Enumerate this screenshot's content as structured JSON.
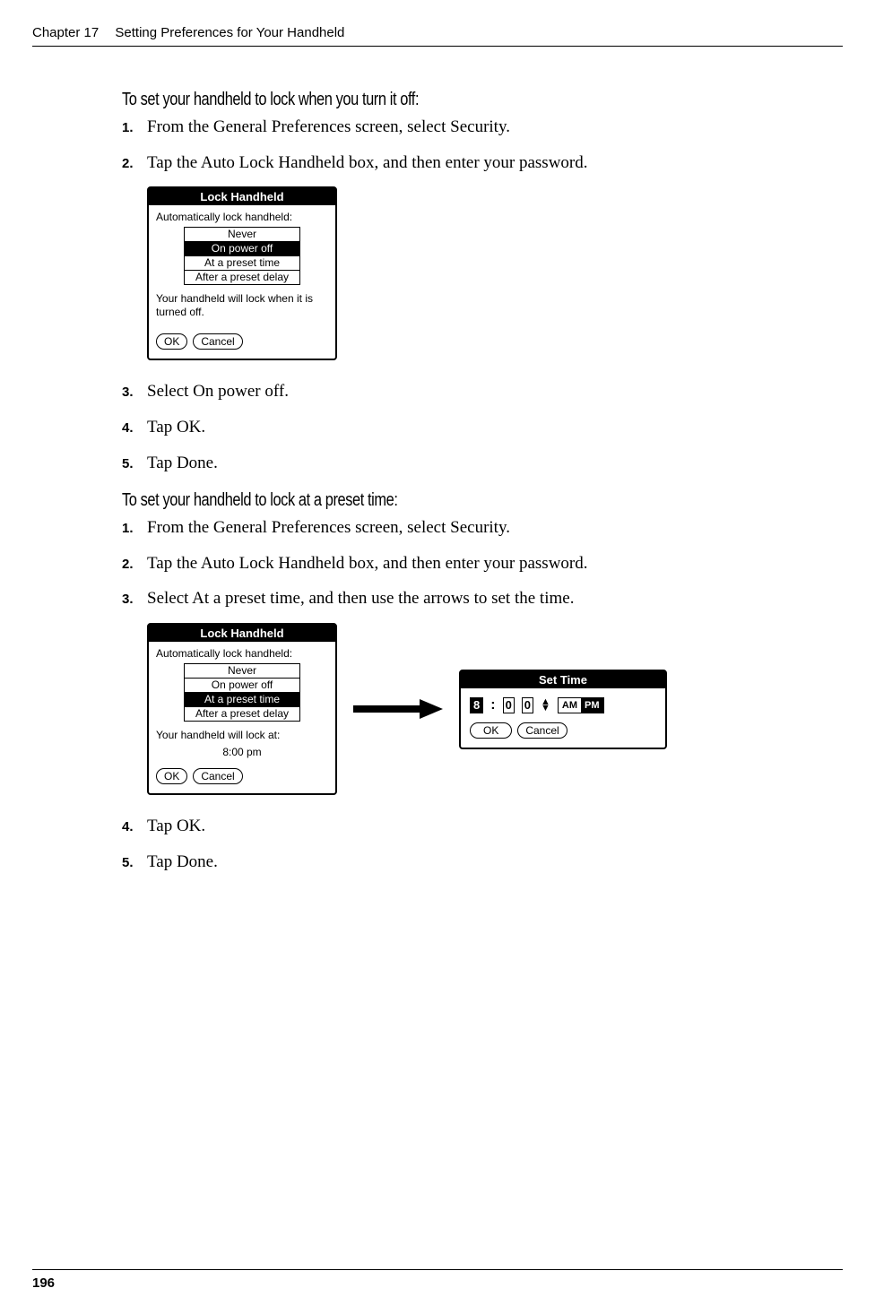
{
  "header": {
    "chapter": "Chapter 17",
    "title": "Setting Preferences for Your Handheld"
  },
  "section1": {
    "heading": "To set your handheld to lock when you turn it off:",
    "steps": [
      "From the General Preferences screen, select Security.",
      "Tap the Auto Lock Handheld box, and then enter your password.",
      "Select On power off.",
      "Tap OK.",
      "Tap Done."
    ]
  },
  "dialog1": {
    "title": "Lock Handheld",
    "prompt": "Automatically lock handheld:",
    "options": [
      "Never",
      "On power off",
      "At a preset time",
      "After a preset delay"
    ],
    "selected_index": 1,
    "note": "Your handheld will lock when it is turned off.",
    "ok": "OK",
    "cancel": "Cancel"
  },
  "section2": {
    "heading": "To set your handheld to lock at a preset time:",
    "steps": [
      "From the General Preferences screen, select Security.",
      "Tap the Auto Lock Handheld box, and then enter your password.",
      "Select At a preset time, and then use the arrows to set the time.",
      "Tap OK.",
      "Tap Done."
    ]
  },
  "dialog2": {
    "title": "Lock Handheld",
    "prompt": "Automatically lock handheld:",
    "options": [
      "Never",
      "On power off",
      "At a preset time",
      "After a preset delay"
    ],
    "selected_index": 2,
    "note": "Your handheld will lock at:",
    "time": "8:00 pm",
    "ok": "OK",
    "cancel": "Cancel"
  },
  "settime": {
    "title": "Set Time",
    "hour": "8",
    "min1": "0",
    "min2": "0",
    "am": "AM",
    "pm": "PM",
    "ampm_selected": "PM",
    "ok": "OK",
    "cancel": "Cancel"
  },
  "page_number": "196"
}
